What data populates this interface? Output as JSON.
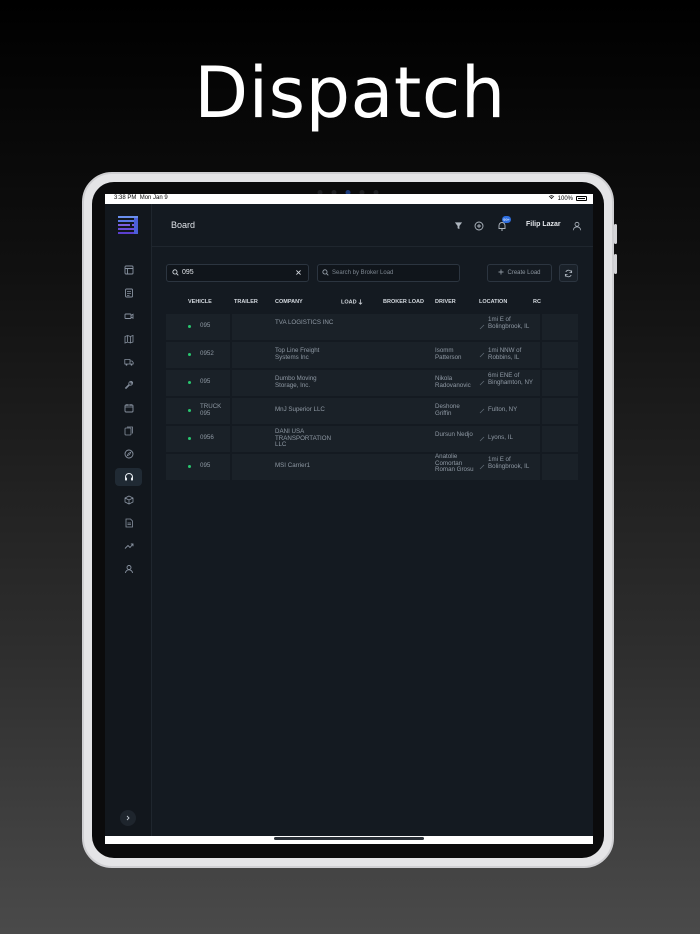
{
  "hero": {
    "title": "Dispatch"
  },
  "status_bar": {
    "time": "3:38 PM",
    "date": "Mon Jan 9",
    "battery": "100%"
  },
  "header": {
    "title": "Board",
    "notification_count": "99+",
    "user_name": "Filip Lazar"
  },
  "toolbar": {
    "search_value": "095",
    "broker_placeholder": "Search by Broker Load",
    "create_label": "Create Load"
  },
  "table": {
    "columns": [
      "VEHICLE",
      "TRAILER",
      "COMPANY",
      "LOAD",
      "BROKER LOAD",
      "DRIVER",
      "LOCATION",
      "RC"
    ],
    "rows": [
      {
        "vehicle": "095",
        "trailer": "",
        "company": "TVA LOGISTICS INC",
        "load": "",
        "broker_load": "",
        "driver": "",
        "location": "1mi E of Bolingbrook, IL"
      },
      {
        "vehicle": "0952",
        "trailer": "",
        "company": "Top Line Freight Systems Inc",
        "load": "",
        "broker_load": "",
        "driver": "Isomm Patterson",
        "location": "1mi NNW of Robbins, IL"
      },
      {
        "vehicle": "095",
        "trailer": "",
        "company": "Dumbo Moving Storage, Inc.",
        "load": "",
        "broker_load": "",
        "driver": "Nikola Radovanovic",
        "location": "6mi ENE of Binghamton, NY"
      },
      {
        "vehicle": "TRUCK 095",
        "trailer": "",
        "company": "MnJ Superior LLC",
        "load": "",
        "broker_load": "",
        "driver": "Deshone Griffin",
        "location": "Fulton, NY"
      },
      {
        "vehicle": "0956",
        "trailer": "",
        "company": "DANI USA TRANSPORTATION LLC",
        "load": "",
        "broker_load": "",
        "driver": "Dursun Nedjo",
        "location": "Lyons, IL"
      },
      {
        "vehicle": "095",
        "trailer": "",
        "company": "MSI Carrier1",
        "load": "",
        "broker_load": "",
        "driver": "Anatolie Comortan Roman Grosu",
        "location": "1mi E of Bolingbrook, IL"
      }
    ]
  },
  "sidebar": {
    "icons": [
      "dashboard-icon",
      "invoice-icon",
      "camera-icon",
      "map-icon",
      "truck-icon",
      "wrench-icon",
      "calendar-icon",
      "documents-icon",
      "compass-icon",
      "headset-icon",
      "package-icon",
      "report-icon",
      "trending-icon",
      "user-icon"
    ],
    "active_index": 9
  },
  "colors": {
    "accent": "#2f6fe0",
    "status_active": "#28c76f",
    "background": "#141a21"
  }
}
